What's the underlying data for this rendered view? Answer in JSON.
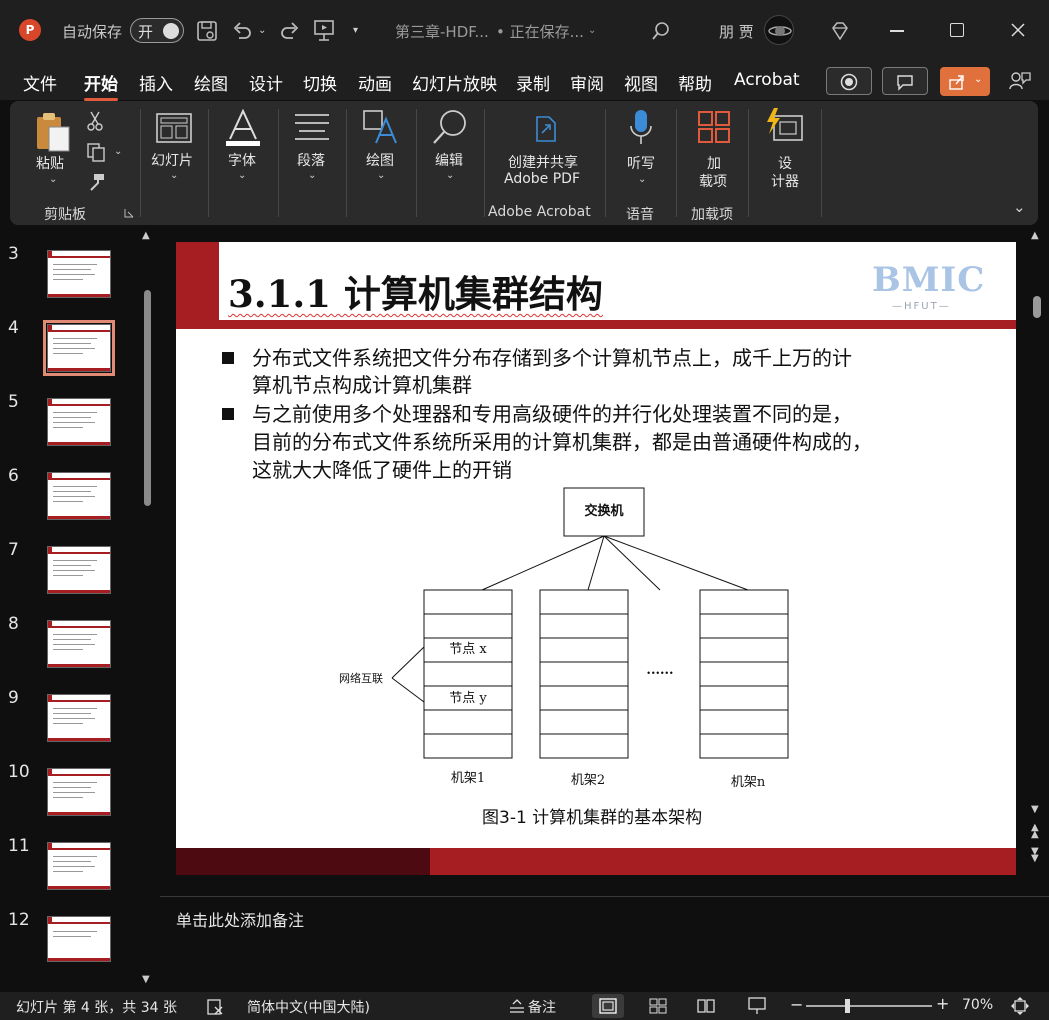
{
  "titlebar": {
    "autosave_label": "自动保存",
    "autosave_toggle": "开",
    "doc_title": "第三章-HDF...",
    "save_status": "• 正在保存...",
    "user_name": "朋 贾"
  },
  "menu": {
    "tabs": [
      "文件",
      "开始",
      "插入",
      "绘图",
      "设计",
      "切换",
      "动画",
      "幻灯片放映",
      "录制",
      "审阅",
      "视图",
      "帮助",
      "Acrobat"
    ]
  },
  "ribbon": {
    "paste": "粘贴",
    "clipboard_group": "剪贴板",
    "slides": "幻灯片",
    "font": "字体",
    "paragraph": "段落",
    "drawing": "绘图",
    "editing": "编辑",
    "create_share_line1": "创建并共享",
    "create_share_line2": "Adobe PDF",
    "acrobat_group": "Adobe Acrobat",
    "dictate": "听写",
    "voice_group": "语音",
    "addins_line1": "加",
    "addins_line2": "载项",
    "addins_group": "加载项",
    "designer_line1": "设",
    "designer_line2": "计器"
  },
  "thumbnails": [
    "3",
    "4",
    "5",
    "6",
    "7",
    "8",
    "9",
    "10",
    "11",
    "12"
  ],
  "slide": {
    "title": "3.1.1  计算机集群结构",
    "logo_text": "BMIC",
    "logo_sub": "—HFUT—",
    "bullets": [
      [
        "分布式文件系统把文件分布存储到多个计算机节点上，成千上万的计",
        "算机节点构成计算机集群"
      ],
      [
        "与之前使用多个处理器和专用高级硬件的并行化处理装置不同的是，",
        "目前的分布式文件系统所采用的计算机集群，都是由普通硬件构成的，",
        "这就大大降低了硬件上的开销"
      ]
    ],
    "diagram": {
      "switch": "交换机",
      "network": "网络互联",
      "node_x": "节点 x",
      "node_y": "节点 y",
      "dots": "......",
      "rack1": "机架1",
      "rack2": "机架2",
      "rackn": "机架n"
    },
    "caption": "图3-1 计算机集群的基本架构"
  },
  "notes_placeholder": "单击此处添加备注",
  "status": {
    "slide_info": "幻灯片 第 4 张，共 34 张",
    "language": "简体中文(中国大陆)",
    "notes_btn": "备注",
    "zoom": "70%"
  },
  "colors": {
    "accent": "#e05a3c",
    "slide_red": "#a61e22",
    "slide_dark_red": "#4d0a10"
  }
}
